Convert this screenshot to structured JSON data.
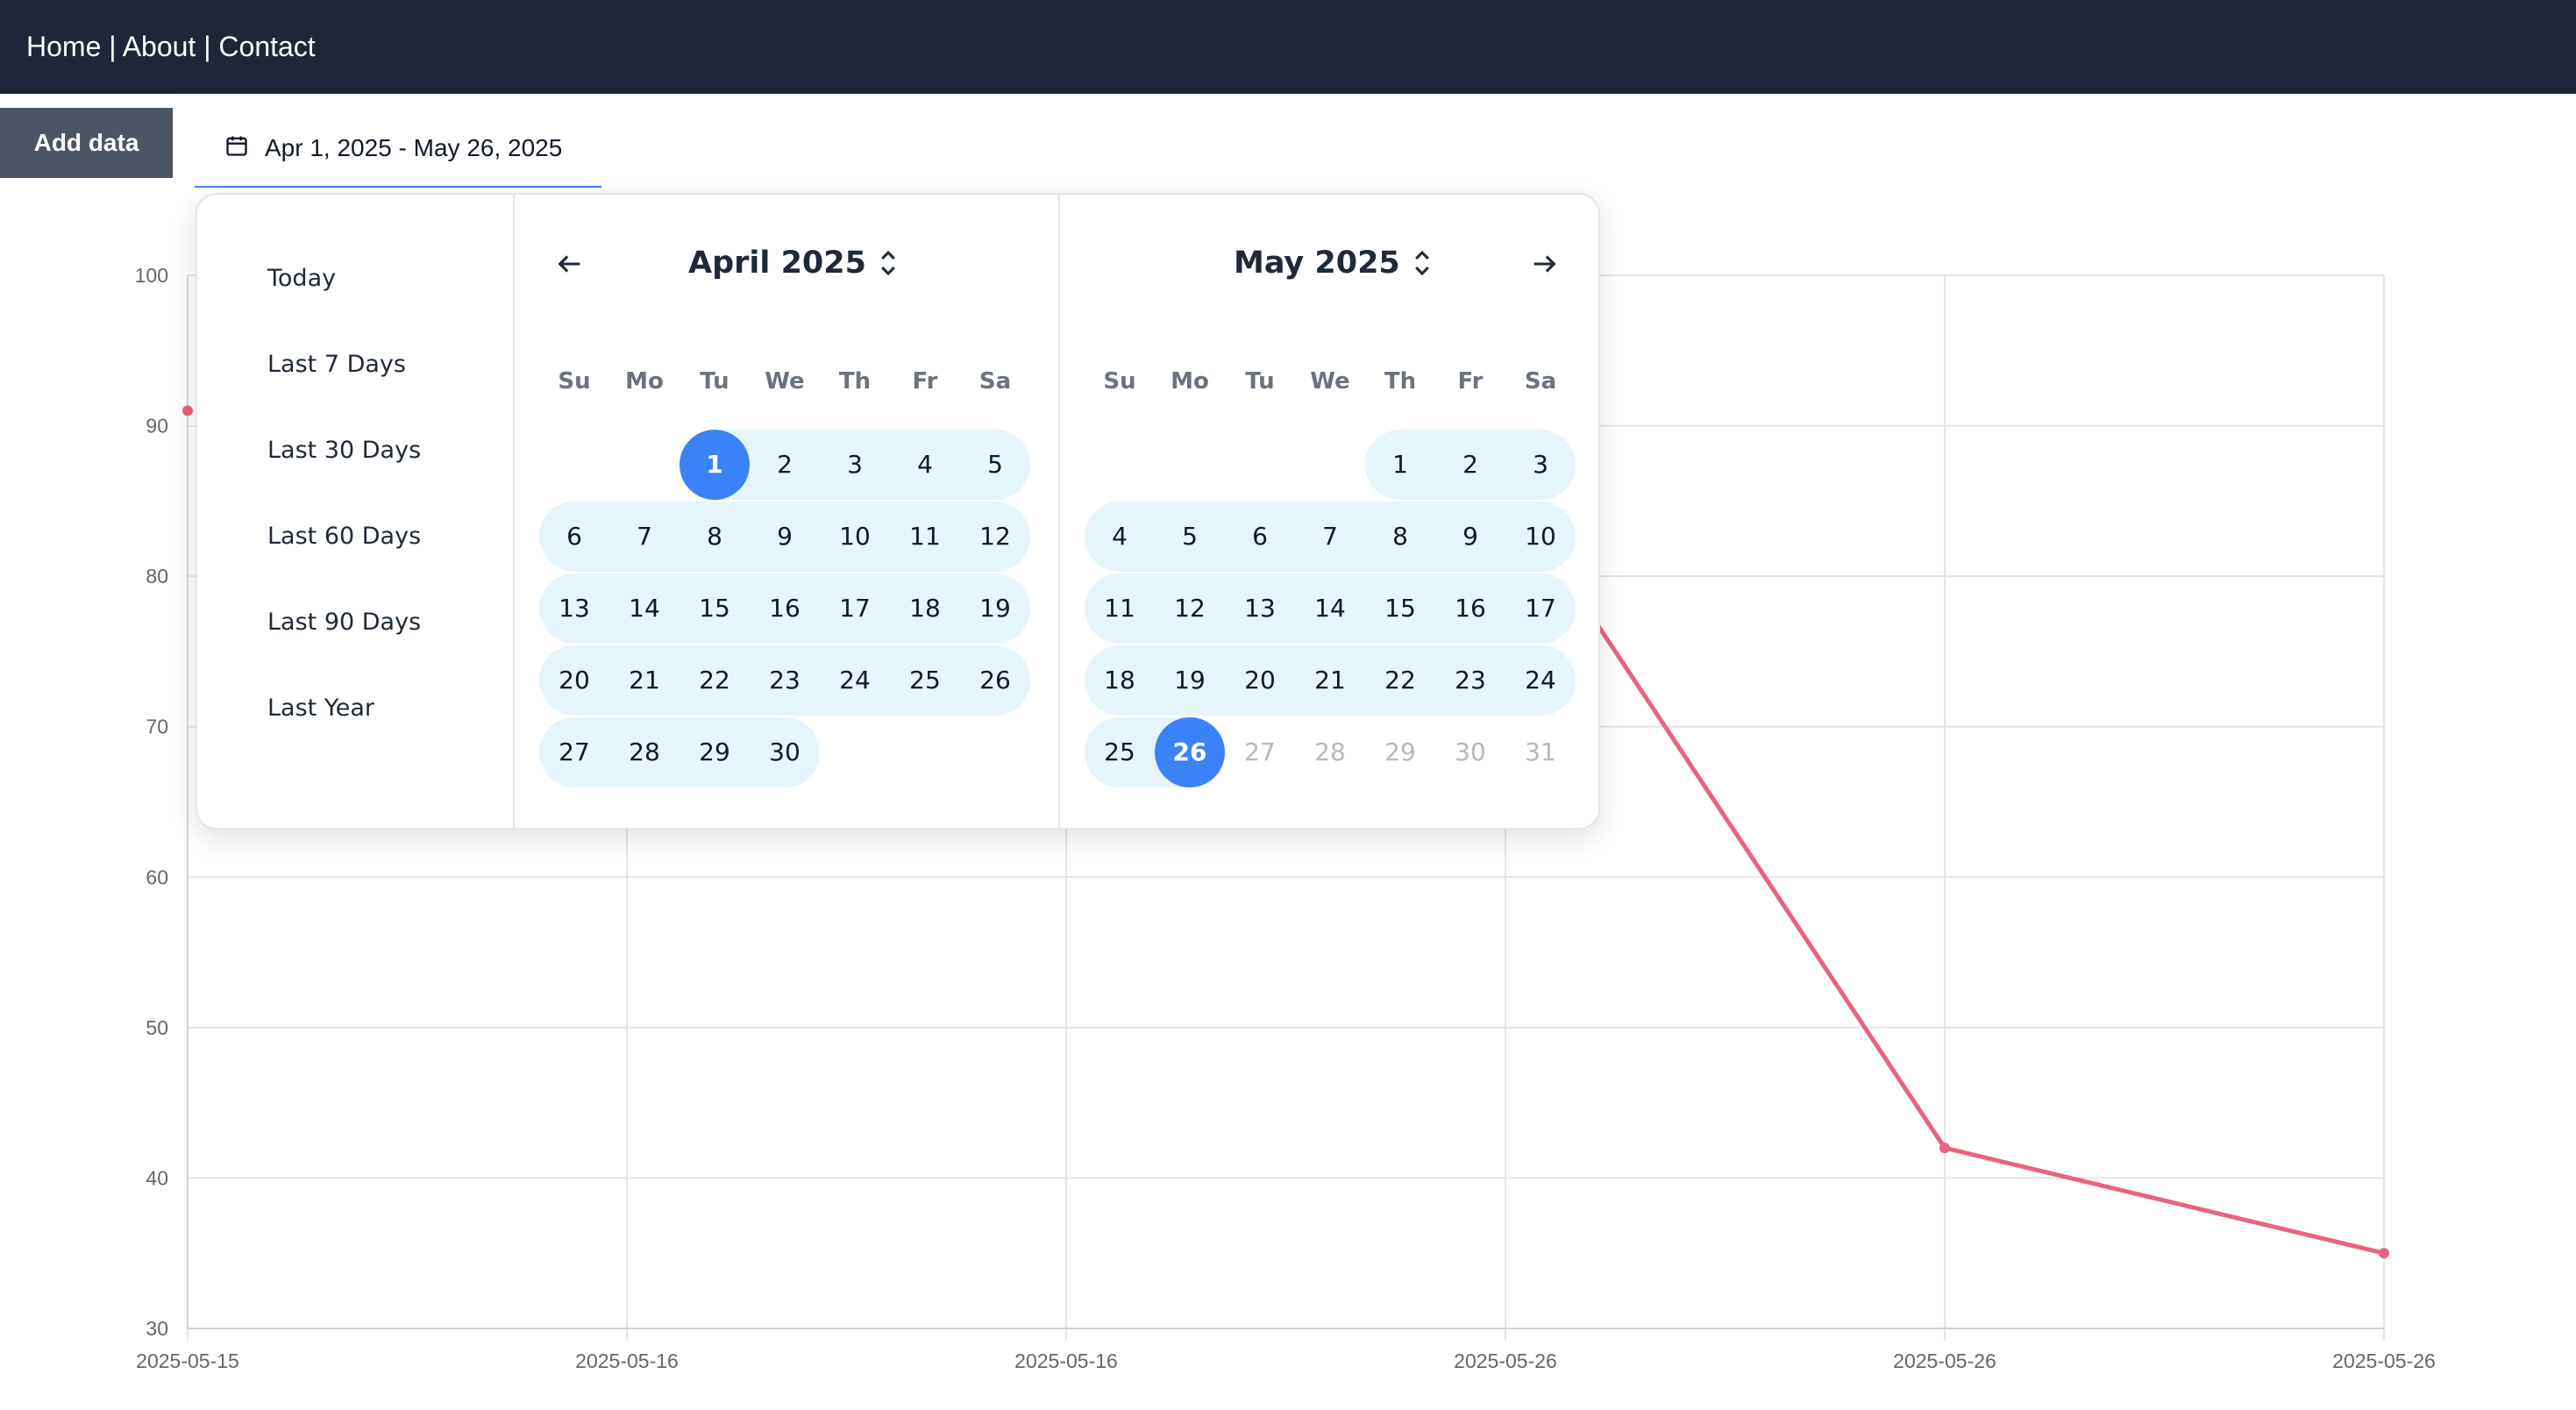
{
  "nav": {
    "links_text": "Home | About | Contact"
  },
  "toolbar": {
    "add_data_label": "Add data"
  },
  "date_range": {
    "label": "Apr 1, 2025 - May 26, 2025",
    "icon": "calendar-icon"
  },
  "picker": {
    "presets": [
      "Today",
      "Last 7 Days",
      "Last 30 Days",
      "Last 60 Days",
      "Last 90 Days",
      "Last Year"
    ],
    "weekdays": [
      "Su",
      "Mo",
      "Tu",
      "We",
      "Th",
      "Fr",
      "Sa"
    ],
    "months": [
      {
        "title": "April 2025",
        "start_weekday": 2,
        "days_in_month": 30,
        "range_start": 1,
        "range_end": 30,
        "selected": [
          1
        ]
      },
      {
        "title": "May 2025",
        "start_weekday": 4,
        "days_in_month": 31,
        "range_start": 1,
        "range_end": 26,
        "selected": [
          26
        ]
      }
    ],
    "prev_icon": "arrow-left-icon",
    "next_icon": "arrow-right-icon",
    "month_select_icon": "chevron-up-down-icon",
    "colors": {
      "selected": "#3b82f6",
      "range": "#e6f4fb",
      "muted": "#b4b9c2"
    }
  },
  "chart_data": {
    "type": "line",
    "x": [
      "2025-05-15",
      "2025-05-16",
      "2025-05-16",
      "2025-05-26",
      "2025-05-26",
      "2025-05-26"
    ],
    "series": [
      {
        "values": [
          91,
          null,
          null,
          86,
          42,
          35
        ],
        "color": "#e8647e"
      }
    ],
    "yticks": [
      30,
      40,
      50,
      60,
      70,
      80,
      90,
      100
    ],
    "ylim": [
      30,
      100
    ],
    "grid": true
  }
}
